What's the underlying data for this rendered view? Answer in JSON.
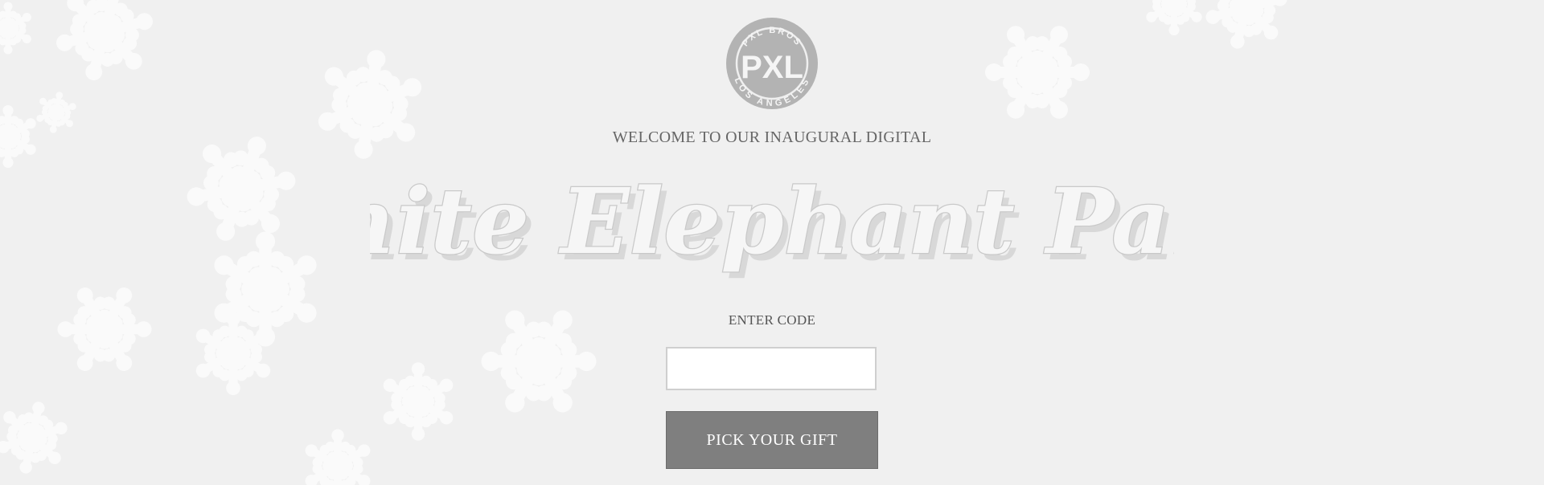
{
  "logo": {
    "top_text": "PXL BROS",
    "monogram": "PXL",
    "bottom_text": "LOS ANGELES"
  },
  "header": {
    "welcome": "WELCOME TO OUR INAUGURAL DIGITAL",
    "title": "White Elephant Party"
  },
  "form": {
    "code_label": "ENTER CODE",
    "code_value": "",
    "submit_label": "PICK YOUR GIFT"
  },
  "colors": {
    "background": "#f0f0f0",
    "snowflake": "#fafafa",
    "button": "#7f7f7f",
    "text": "#666666"
  }
}
